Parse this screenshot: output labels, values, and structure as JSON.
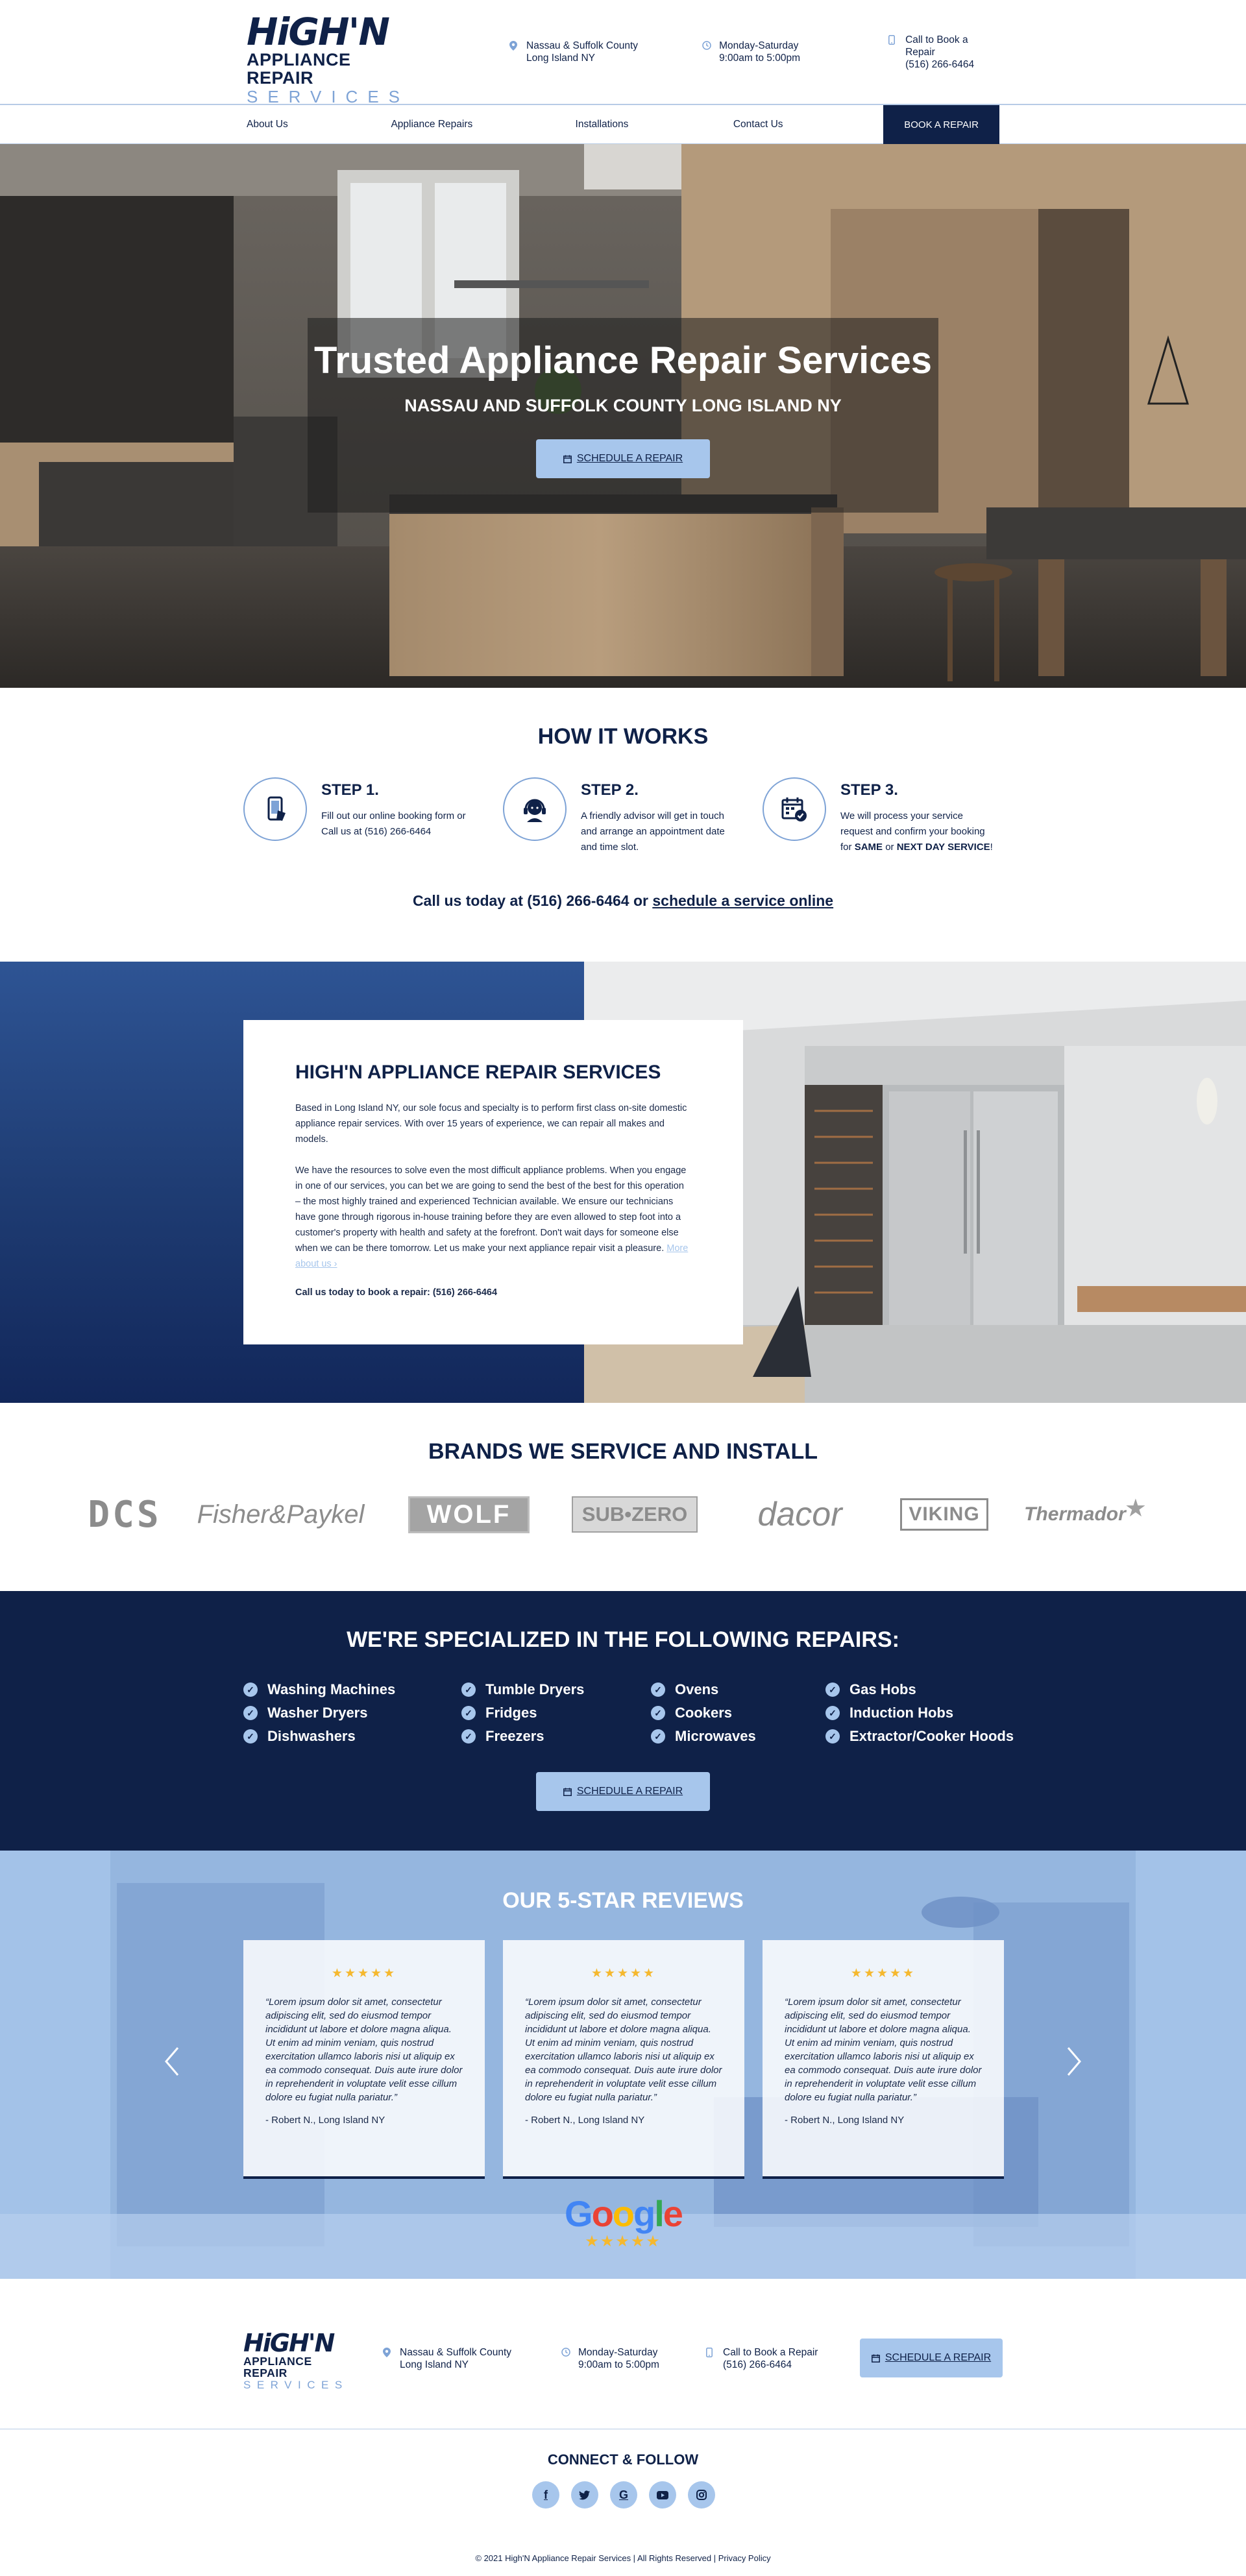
{
  "brand": {
    "logo_top": "HiGH'N",
    "logo_mid": "APPLIANCE REPAIR",
    "logo_bot": "SERVICES"
  },
  "header": {
    "location_line1": "Nassau & Suffolk County",
    "location_line2": "Long Island NY",
    "hours_line1": "Monday-Saturday",
    "hours_line2": "9:00am to 5:00pm",
    "phone_line1": "Call to Book a Repair",
    "phone_line2": "(516) 266-6464"
  },
  "nav": {
    "items": [
      "About Us",
      "Appliance Repairs",
      "Installations",
      "Contact Us"
    ],
    "book_label": "BOOK A REPAIR"
  },
  "hero": {
    "title": "Trusted Appliance Repair Services",
    "subtitle": "NASSAU AND SUFFOLK COUNTY LONG ISLAND NY",
    "button_label": "SCHEDULE A REPAIR"
  },
  "how": {
    "title": "HOW IT WORKS",
    "steps": [
      {
        "title": "STEP 1.",
        "text": "Fill out our online booking form or Call us at (516) 266-6464",
        "icon": "phone-icon"
      },
      {
        "title": "STEP 2.",
        "text": "A friendly advisor will get in touch and arrange an appointment date and time slot.",
        "icon": "headset-icon"
      },
      {
        "title": "STEP 3.",
        "text_a": "We will  process your service request and confirm your booking for ",
        "text_b": "SAME",
        "text_c": " or ",
        "text_d": "NEXT DAY SERVICE",
        "text_e": "!",
        "icon": "calendar-check-icon"
      }
    ],
    "call_prefix": "Call us today at (516) 266-6464 or ",
    "call_link": "schedule a service online"
  },
  "about": {
    "title": "HIGH'N APPLIANCE REPAIR SERVICES",
    "p1": "Based in Long Island NY, our sole focus and specialty is to perform first class on-site domestic appliance repair services. With over 15 years of experience, we can repair all makes and models.",
    "p2": "We have the resources to solve even the most difficult appliance problems. When you engage in one of our services, you can bet we are going to send the best of the best for this operation – the most highly trained and experienced Technician available. We ensure our technicians have gone through rigorous in-house training before they are even allowed to step foot into a customer's property with health and safety at the forefront. Don't wait days for someone else when we can be there tomorrow. Let us make your next appliance repair visit a pleasure. ",
    "more": "More about us ›",
    "call": "Call us today to book a repair: (516) 266-6464"
  },
  "brands": {
    "title": "BRANDS WE SERVICE AND INSTALL",
    "items": [
      "DCS",
      "Fisher&Paykel",
      "WOLF",
      "SUB•ZERO",
      "dacor",
      "VIKING",
      "Thermador"
    ]
  },
  "repairs": {
    "title": "WE'RE SPECIALIZED IN THE FOLLOWING REPAIRS:",
    "items": [
      "Washing Machines",
      "Washer Dryers",
      "Dishwashers",
      "Tumble Dryers",
      "Fridges",
      "Freezers",
      "Ovens",
      "Cookers",
      "Microwaves",
      "Gas Hobs",
      "Induction Hobs",
      "Extractor/Cooker Hoods"
    ],
    "button_label": "SCHEDULE A REPAIR"
  },
  "reviews": {
    "title": "OUR 5-STAR REVIEWS",
    "items": [
      {
        "stars": "★★★★★",
        "text": "“Lorem ipsum dolor sit amet, consectetur adipiscing elit, sed do eiusmod tempor incididunt ut labore et dolore magna aliqua. Ut enim ad minim veniam, quis nostrud exercitation ullamco laboris nisi ut aliquip ex ea commodo consequat. Duis aute irure dolor in reprehenderit in voluptate velit esse cillum dolore eu fugiat nulla pariatur.”",
        "author": "- Robert N., Long Island NY"
      },
      {
        "stars": "★★★★★",
        "text": "“Lorem ipsum dolor sit amet, consectetur adipiscing elit, sed do eiusmod tempor incididunt ut labore et dolore magna aliqua. Ut enim ad minim veniam, quis nostrud exercitation ullamco laboris nisi ut aliquip ex ea commodo consequat. Duis aute irure dolor in reprehenderit in voluptate velit esse cillum dolore eu fugiat nulla pariatur.”",
        "author": "- Robert N., Long Island NY"
      },
      {
        "stars": "★★★★★",
        "text": "“Lorem ipsum dolor sit amet, consectetur adipiscing elit, sed do eiusmod tempor incididunt ut labore et dolore magna aliqua. Ut enim ad minim veniam, quis nostrud exercitation ullamco laboris nisi ut aliquip ex ea commodo consequat. Duis aute irure dolor in reprehenderit in voluptate velit esse cillum dolore eu fugiat nulla pariatur.”",
        "author": "- Robert N., Long Island NY"
      }
    ],
    "google_word": "Google",
    "google_stars": "★★★★★"
  },
  "footer": {
    "location_line1": "Nassau & Suffolk County",
    "location_line2": "Long Island NY",
    "hours_line1": "Monday-Saturday",
    "hours_line2": "9:00am to 5:00pm",
    "phone_line1": "Call to Book a Repair",
    "phone_line2": "(516) 266-6464",
    "button_label": "SCHEDULE A REPAIR",
    "connect_title": "CONNECT & FOLLOW",
    "socials": [
      "facebook-icon",
      "twitter-icon",
      "google-icon",
      "youtube-icon",
      "instagram-icon"
    ],
    "copyright": "© 2021 High'N Appliance Repair Services  |  All Rights Reserved  |  Privacy Policy"
  },
  "colors": {
    "navy": "#0f2148",
    "light_blue": "#a7c6ec",
    "accent_blue": "#7ea3d6",
    "star_yellow": "#f5b82e"
  }
}
